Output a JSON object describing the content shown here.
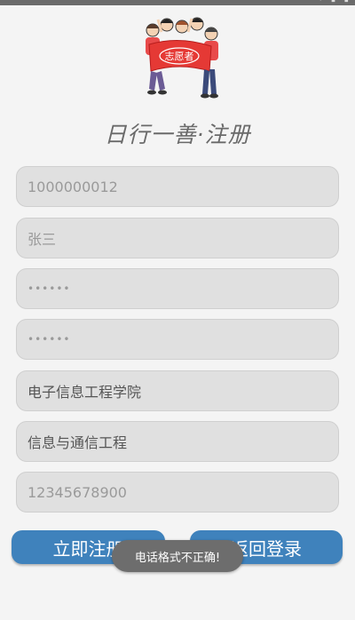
{
  "title": "日行一善·注册",
  "logo": {
    "banner_text": "志愿者"
  },
  "form": {
    "phone_placeholder": "1000000012",
    "name_placeholder": "张三",
    "password_mask": "••••••",
    "confirm_password_mask": "••••••",
    "college_value": "电子信息工程学院",
    "major_value": "信息与通信工程",
    "contact_placeholder": "12345678900"
  },
  "buttons": {
    "register_label": "立即注册",
    "back_label": "返回登录"
  },
  "toast": {
    "message": "电话格式不正确!"
  },
  "colors": {
    "button": "#3f82bc",
    "field_bg": "#e0e0e0",
    "toast_bg": "#6d6d6d",
    "banner": "#e53935"
  }
}
